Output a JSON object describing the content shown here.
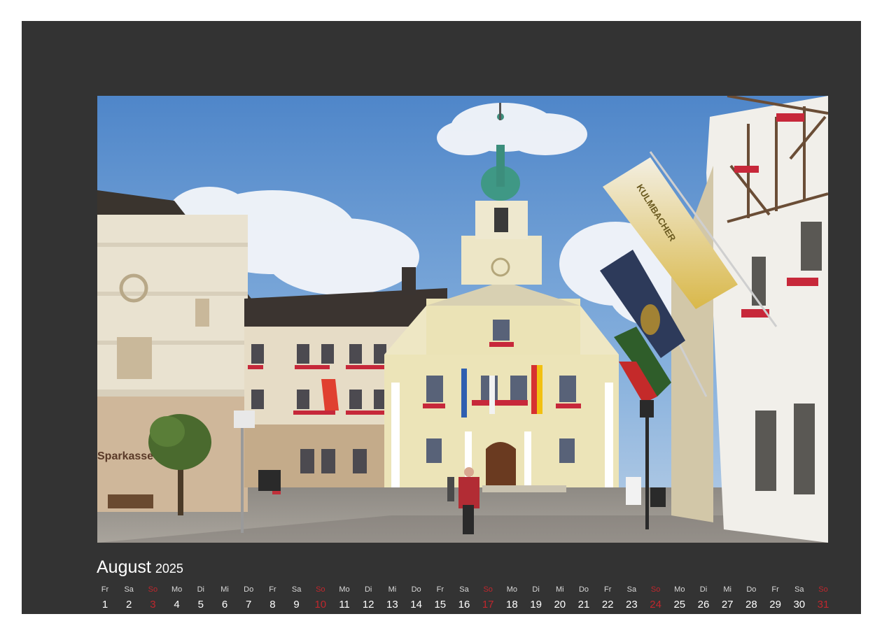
{
  "calendar": {
    "month": "August",
    "year": "2025",
    "colors": {
      "background": "#333333",
      "text": "#ffffff",
      "sunday": "#c0272d"
    },
    "days": [
      {
        "wd": "Fr",
        "d": "1"
      },
      {
        "wd": "Sa",
        "d": "2"
      },
      {
        "wd": "So",
        "d": "3"
      },
      {
        "wd": "Mo",
        "d": "4"
      },
      {
        "wd": "Di",
        "d": "5"
      },
      {
        "wd": "Mi",
        "d": "6"
      },
      {
        "wd": "Do",
        "d": "7"
      },
      {
        "wd": "Fr",
        "d": "8"
      },
      {
        "wd": "Sa",
        "d": "9"
      },
      {
        "wd": "So",
        "d": "10"
      },
      {
        "wd": "Mo",
        "d": "11"
      },
      {
        "wd": "Di",
        "d": "12"
      },
      {
        "wd": "Mi",
        "d": "13"
      },
      {
        "wd": "Do",
        "d": "14"
      },
      {
        "wd": "Fr",
        "d": "15"
      },
      {
        "wd": "Sa",
        "d": "16"
      },
      {
        "wd": "So",
        "d": "17"
      },
      {
        "wd": "Mo",
        "d": "18"
      },
      {
        "wd": "Di",
        "d": "19"
      },
      {
        "wd": "Mi",
        "d": "20"
      },
      {
        "wd": "Do",
        "d": "21"
      },
      {
        "wd": "Fr",
        "d": "22"
      },
      {
        "wd": "Sa",
        "d": "23"
      },
      {
        "wd": "So",
        "d": "24"
      },
      {
        "wd": "Mo",
        "d": "25"
      },
      {
        "wd": "Di",
        "d": "26"
      },
      {
        "wd": "Mi",
        "d": "27"
      },
      {
        "wd": "Do",
        "d": "28"
      },
      {
        "wd": "Fr",
        "d": "29"
      },
      {
        "wd": "Sa",
        "d": "30"
      },
      {
        "wd": "So",
        "d": "31"
      }
    ]
  },
  "photo": {
    "sign_text": "Sparkasse",
    "flag_text_1": "KULMBACHER",
    "flag_text_2": "KULMBACHER"
  }
}
